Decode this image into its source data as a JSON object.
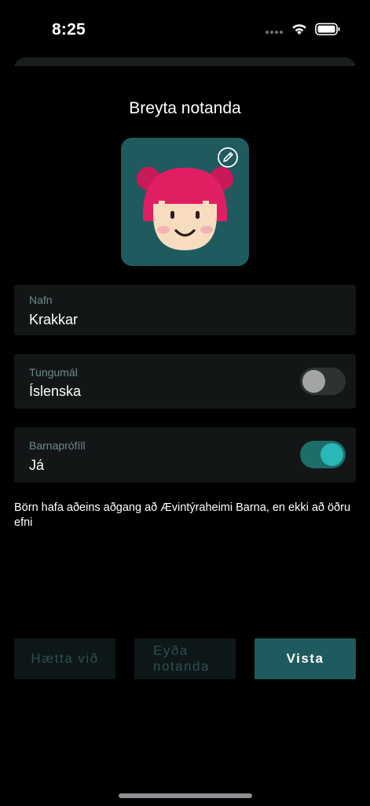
{
  "status_bar": {
    "time": "8:25",
    "signal_icon": "signal-dots-icon",
    "wifi_icon": "wifi-icon",
    "battery_icon": "battery-icon"
  },
  "page": {
    "title": "Breyta notanda"
  },
  "avatar": {
    "icon": "kid-avatar-icon",
    "edit_icon": "edit-pencil-icon",
    "background_color": "#1f5a5e"
  },
  "fields": {
    "name": {
      "label": "Nafn",
      "value": "Krakkar"
    },
    "language": {
      "label": "Tungumál",
      "value": "Íslenska",
      "toggle_on": false
    },
    "kids_profile": {
      "label": "Barnaprófíll",
      "value": "Já",
      "toggle_on": true
    }
  },
  "help_text": "Börn hafa aðeins aðgang að Ævintýraheimi Barna, en ekki að öðru efni",
  "buttons": {
    "cancel": "Hætta við",
    "delete": "Eyða notanda",
    "save": "Vista"
  },
  "colors": {
    "accent": "#2ab7b7",
    "accent_dark": "#1d6d69",
    "field_background": "#121617",
    "avatar_hair": "#e01f63",
    "avatar_skin": "#f8dcc0"
  }
}
